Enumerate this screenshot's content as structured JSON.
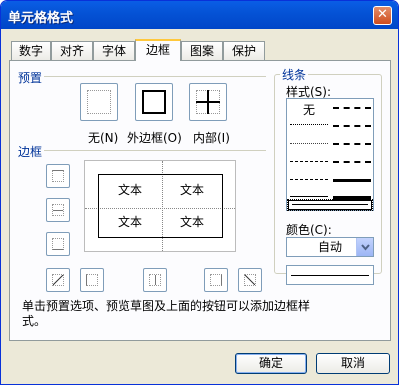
{
  "window": {
    "title": "单元格格式",
    "close_icon": "close-icon"
  },
  "tabs": [
    {
      "label": "数字"
    },
    {
      "label": "对齐"
    },
    {
      "label": "字体"
    },
    {
      "label": "边框"
    },
    {
      "label": "图案"
    },
    {
      "label": "保护"
    }
  ],
  "active_tab": "边框",
  "presets": {
    "group_label": "预置",
    "none_label": "无(N)",
    "outline_label": "外边框(O)",
    "inside_label": "内部(I)"
  },
  "border": {
    "group_label": "边框",
    "preview_cells": [
      "文本",
      "文本",
      "文本",
      "文本"
    ]
  },
  "line": {
    "group_label": "线条",
    "style_label": "样式(S):",
    "none_option": "无",
    "color_label": "颜色(C):",
    "color_value": "自动"
  },
  "info_text": "单击预置选项、预览草图及上面的按钮可以添加边框样式。",
  "buttons": {
    "ok": "确定",
    "cancel": "取消"
  }
}
